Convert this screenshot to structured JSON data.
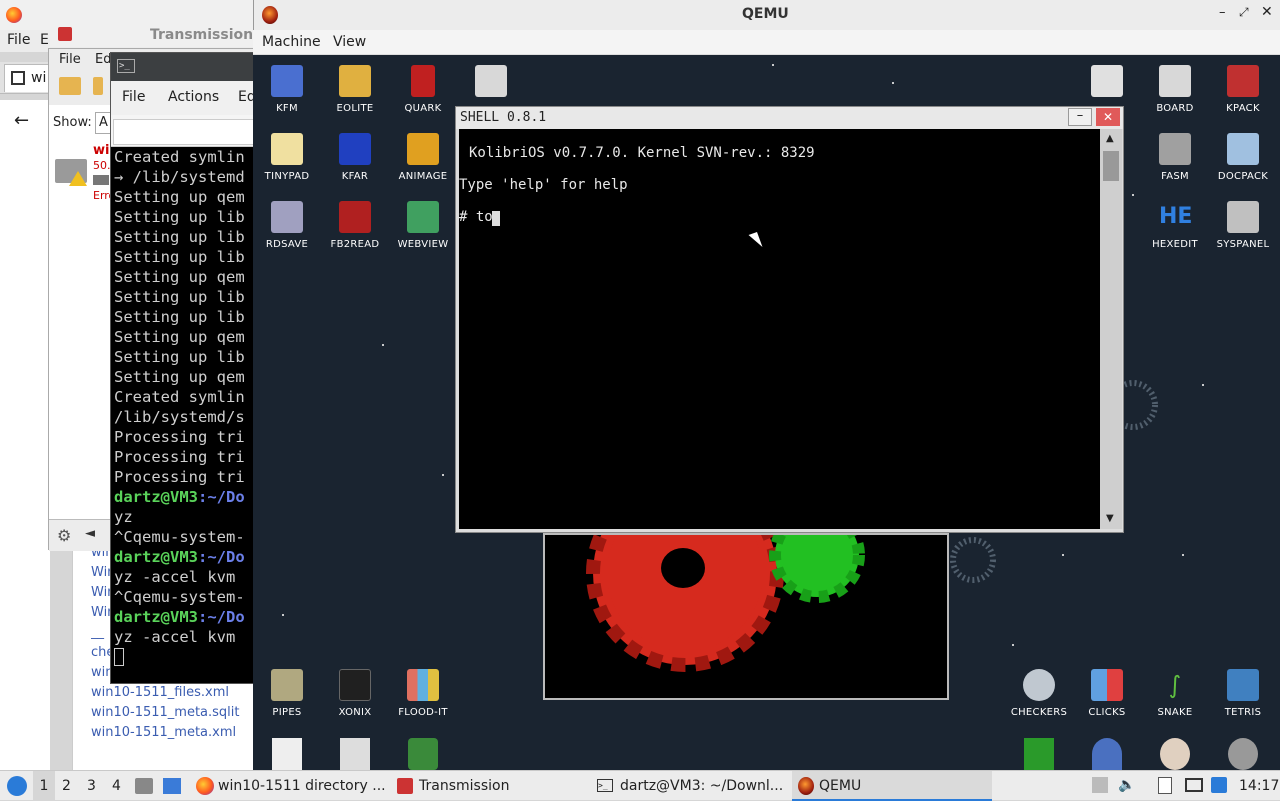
{
  "host": {
    "firefox_menu": {
      "file": "File",
      "edit": "E"
    },
    "tab_label": "wi",
    "transmission": {
      "title": "Transmission",
      "menu": {
        "file": "File",
        "edit": "Ed"
      },
      "torrent": {
        "name": "wi",
        "size": "50.",
        "status": "Erro"
      },
      "search_placeholder": "A",
      "show_label": "Show:"
    },
    "file_list": [
      "win",
      "Win",
      "Win",
      "Win",
      "__",
      "che",
      "win",
      "win10-1511_files.xml",
      "win10-1511_meta.sqlit",
      "win10-1511_meta.xml"
    ]
  },
  "terminal": {
    "menu": {
      "file": "File",
      "actions": "Actions",
      "edit": "Ed"
    },
    "lines": [
      {
        "text": "Created symlin",
        "color": "#cfcfcf"
      },
      {
        "text": "→ /lib/systemd",
        "color": "#cfcfcf"
      },
      {
        "text": "Setting up qem",
        "color": "#cfcfcf"
      },
      {
        "text": "Setting up lib",
        "color": "#cfcfcf"
      },
      {
        "text": "Setting up lib",
        "color": "#cfcfcf"
      },
      {
        "text": "Setting up lib",
        "color": "#cfcfcf"
      },
      {
        "text": "Setting up qem",
        "color": "#cfcfcf"
      },
      {
        "text": "Setting up lib",
        "color": "#cfcfcf"
      },
      {
        "text": "Setting up lib",
        "color": "#cfcfcf"
      },
      {
        "text": "Setting up qem",
        "color": "#cfcfcf"
      },
      {
        "text": "Setting up lib",
        "color": "#cfcfcf"
      },
      {
        "text": "Setting up qem",
        "color": "#cfcfcf"
      },
      {
        "text": "Created symlin",
        "color": "#cfcfcf"
      },
      {
        "text": "/lib/systemd/s",
        "color": "#cfcfcf"
      },
      {
        "text": "Processing tri",
        "color": "#cfcfcf"
      },
      {
        "text": "Processing tri",
        "color": "#cfcfcf"
      },
      {
        "text": "Processing tri",
        "color": "#cfcfcf"
      },
      {
        "prompt": "dartz@VM3",
        "path": ":~/Do"
      },
      {
        "text": "yz",
        "color": "#cfcfcf"
      },
      {
        "text": "^Cqemu-system-",
        "color": "#cfcfcf"
      },
      {
        "prompt": "dartz@VM3",
        "path": ":~/Do"
      },
      {
        "text": "yz -accel kvm",
        "color": "#cfcfcf"
      },
      {
        "text": "^Cqemu-system-",
        "color": "#cfcfcf"
      },
      {
        "prompt": "dartz@VM3",
        "path": ":~/Do"
      },
      {
        "text": "yz -accel kvm",
        "color": "#cfcfcf"
      }
    ],
    "prompt_color": "#5ad35a",
    "path_color": "#6b7fe8"
  },
  "qemu": {
    "title": "QEMU",
    "menu": {
      "machine": "Machine",
      "view": "View"
    },
    "desktop_icons": [
      {
        "label": "KFM",
        "icon": "kfm-icon",
        "color": "#4a6fd0"
      },
      {
        "label": "EOLITE",
        "icon": "eolite-icon",
        "color": "#e0b040"
      },
      {
        "label": "QUARK",
        "icon": "quark-icon",
        "color": "#c02020"
      },
      {
        "label": "",
        "icon": "calculator-icon",
        "color": "#d8d8d8"
      },
      {
        "label": "TINYPAD",
        "icon": "tinypad-icon",
        "color": "#f0e0a0"
      },
      {
        "label": "KFAR",
        "icon": "kfar-icon",
        "color": "#2040c0"
      },
      {
        "label": "ANIMAGE",
        "icon": "animage-icon",
        "color": "#e0a020"
      },
      {
        "label": "RDSAVE",
        "icon": "rdsave-icon",
        "color": "#a0a0c0"
      },
      {
        "label": "FB2READ",
        "icon": "fb2read-icon",
        "color": "#b02020"
      },
      {
        "label": "WEBVIEW",
        "icon": "webview-icon",
        "color": "#40a060"
      },
      {
        "label": "",
        "icon": "settings-icon",
        "color": "#e0e0e0"
      },
      {
        "label": "BOARD",
        "icon": "board-icon",
        "color": "#d8d8d8"
      },
      {
        "label": "KPACK",
        "icon": "kpack-icon",
        "color": "#c03030"
      },
      {
        "label": "FASM",
        "icon": "fasm-icon",
        "color": "#a0a0a0"
      },
      {
        "label": "DOCPACK",
        "icon": "docpack-icon",
        "color": "#a0c0e0"
      },
      {
        "label": "HEXEDIT",
        "icon": "hexedit-icon",
        "color": "#3080e0"
      },
      {
        "label": "SYSPANEL",
        "icon": "syspanel-icon",
        "color": "#c0c0c0"
      },
      {
        "label": "PIPES",
        "icon": "pipes-icon",
        "color": "#b0a880"
      },
      {
        "label": "XONIX",
        "icon": "xonix-icon",
        "color": "#202020"
      },
      {
        "label": "FLOOD-IT",
        "icon": "flood-it-icon",
        "color": "#e07060"
      },
      {
        "label": "CHECKERS",
        "icon": "checkers-icon",
        "color": "#c0c8d0"
      },
      {
        "label": "CLICKS",
        "icon": "clicks-icon",
        "color": "#60a0e0"
      },
      {
        "label": "SNAKE",
        "icon": "snake-icon",
        "color": "#60c040"
      },
      {
        "label": "TETRIS",
        "icon": "tetris-icon",
        "color": "#4080c0"
      }
    ],
    "shell": {
      "title": "SHELL 0.8.1",
      "lines": [
        " KolibriOS v0.7.7.0. Kernel SVN-rev.: 8329",
        "Type 'help' for help",
        "# to"
      ]
    }
  },
  "taskbar": {
    "workspaces": [
      "1",
      "2",
      "3",
      "4"
    ],
    "tasks": [
      {
        "label": "win10-1511 directory ...",
        "icon": "firefox-icon"
      },
      {
        "label": "Transmission",
        "icon": "transmission-icon"
      },
      {
        "label": "dartz@VM3: ~/Downl...",
        "icon": "terminal-icon"
      },
      {
        "label": "QEMU",
        "icon": "qemu-icon"
      }
    ],
    "clock": "14:17"
  }
}
